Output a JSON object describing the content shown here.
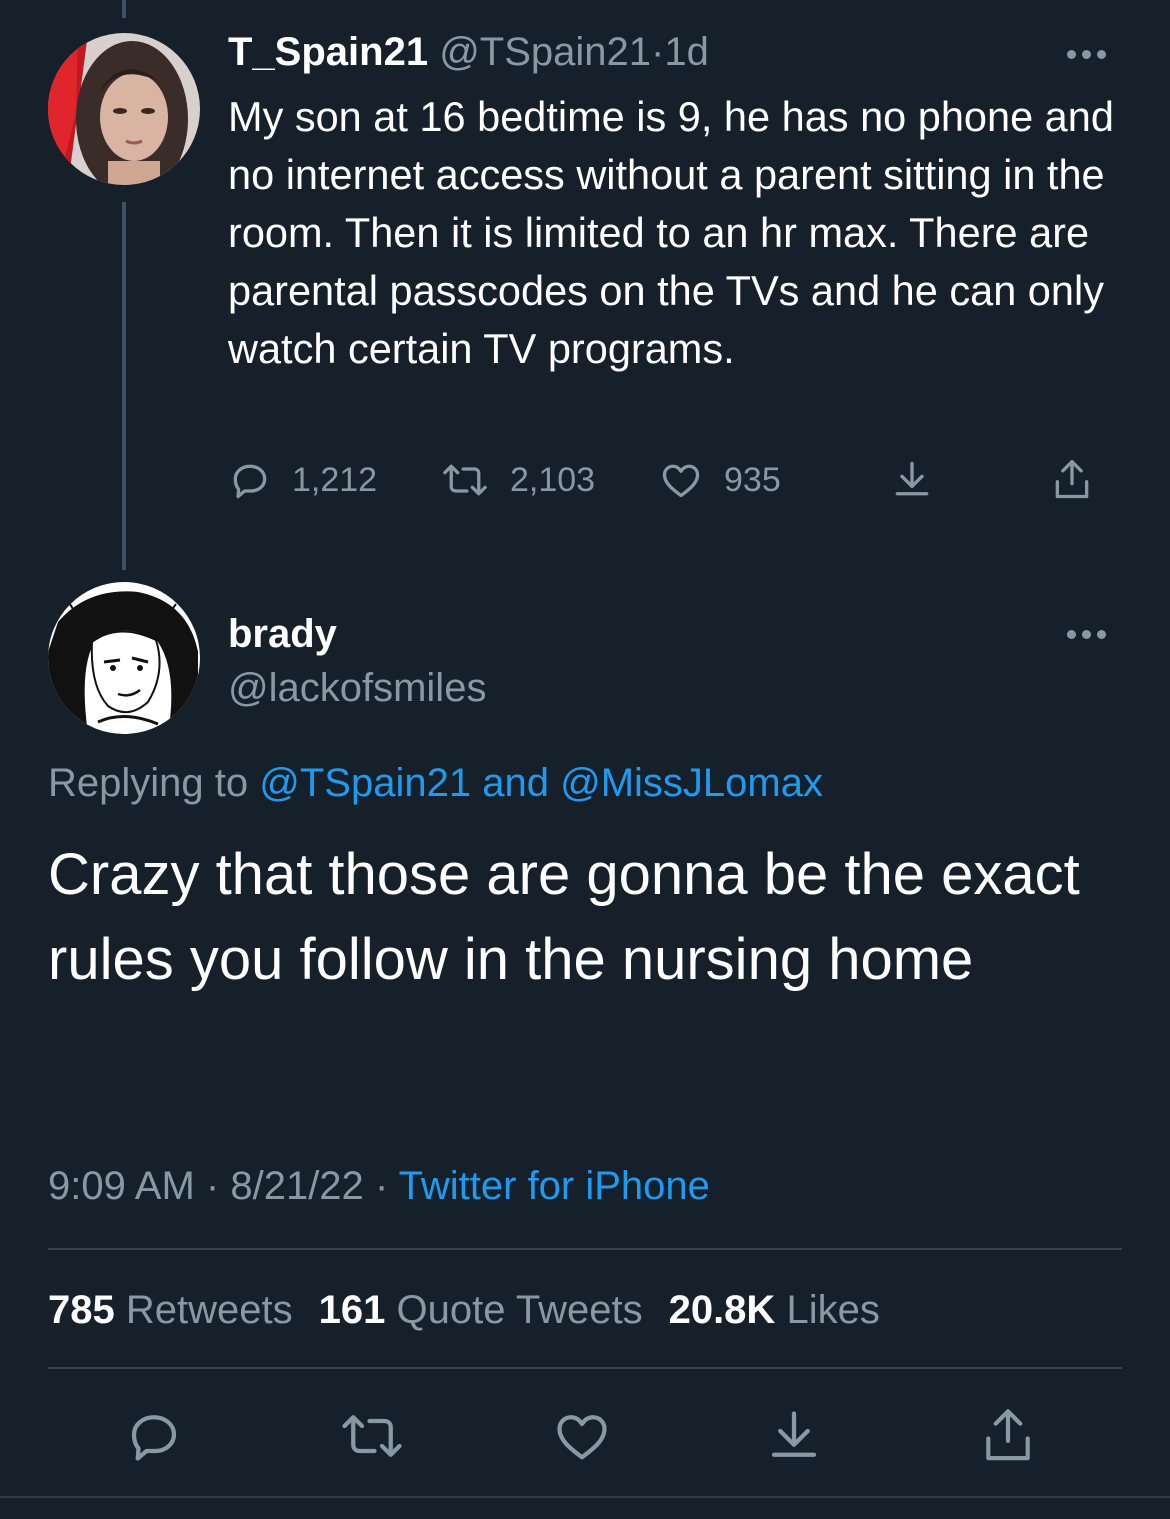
{
  "parent_tweet": {
    "display_name": "T_Spain21",
    "handle": "@TSpain21",
    "separator": "·",
    "age": "1d",
    "text": "My son at 16 bedtime is 9, he has no phone and no internet access without a parent sitting in the room. Then it is limited to an hr max.  There are parental passcodes on the TVs and he can only watch certain TV programs.",
    "reply_count": "1,212",
    "retweet_count": "2,103",
    "like_count": "935"
  },
  "main_tweet": {
    "display_name": "brady",
    "handle": "@lackofsmiles",
    "replying_prefix": "Replying to",
    "replying_mention_1": "@TSpain21",
    "replying_and": "and",
    "replying_mention_2": "@MissJLomax",
    "text": "Crazy that those are gonna be the exact rules you follow in the nursing home",
    "time": "9:09 AM",
    "date": "8/21/22",
    "separator": "·",
    "source": "Twitter for iPhone",
    "retweets_count": "785",
    "retweets_label": "Retweets",
    "quotes_count": "161",
    "quotes_label": "Quote Tweets",
    "likes_count": "20.8K",
    "likes_label": "Likes"
  },
  "colors": {
    "background": "#15202b",
    "text_primary": "#ffffff",
    "text_secondary": "#8899a6",
    "accent": "#1d9bf0",
    "divider": "#38444d"
  },
  "icons": {
    "reply": "reply-icon",
    "retweet": "retweet-icon",
    "like": "heart-icon",
    "bookmark": "bookmark-download-icon",
    "share": "share-icon",
    "more": "more-dots-icon"
  }
}
